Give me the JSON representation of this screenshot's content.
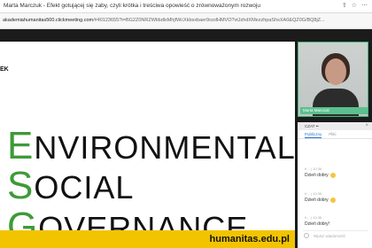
{
  "tab": {
    "title": "Marta Marczuk - Efekt gotującej się żaby, czyli krótka i treściwa opowieść o zrównoważonym rozwoju",
    "icons": [
      "share-icon",
      "star-icon",
      "more-icon"
    ]
  },
  "address": {
    "domain": "akademiahumanitas500.clickmeeting.com",
    "path": "/#40123655?t=BG2Z0NRZWtibdlxMhjfWcXkbsxbaer9ozdHMVO?vtJzhdXMezzhpaShsXA0&QZ0G/BQ8jZ..."
  },
  "slide": {
    "corner_text": "EK",
    "lines": [
      {
        "cap": "E",
        "rest": "NVIRONMENTAL"
      },
      {
        "cap": "S",
        "rest": "OCIAL"
      },
      {
        "cap": "G",
        "rest": "OVERNANCE"
      }
    ],
    "footer_url": "humanitas.edu.pl"
  },
  "video": {
    "name_label": "Marta Marczuk"
  },
  "chat": {
    "header": "CZAT ••",
    "close": "×",
    "tabs": [
      "Publiczny",
      "Pliki"
    ],
    "messages": [
      {
        "meta": "K... | 10:36",
        "text": "Dzień dobry"
      },
      {
        "meta": "K... | 10:36",
        "text": "Dzień dobry"
      },
      {
        "meta": "K... | 10:36",
        "text": "Dzień dobry!"
      }
    ],
    "input_placeholder": "Wpisz wiadomość"
  },
  "colors": {
    "accent_green": "#3e9a39",
    "footer_yellow": "#f2c400",
    "video_border": "#3fb87a"
  }
}
